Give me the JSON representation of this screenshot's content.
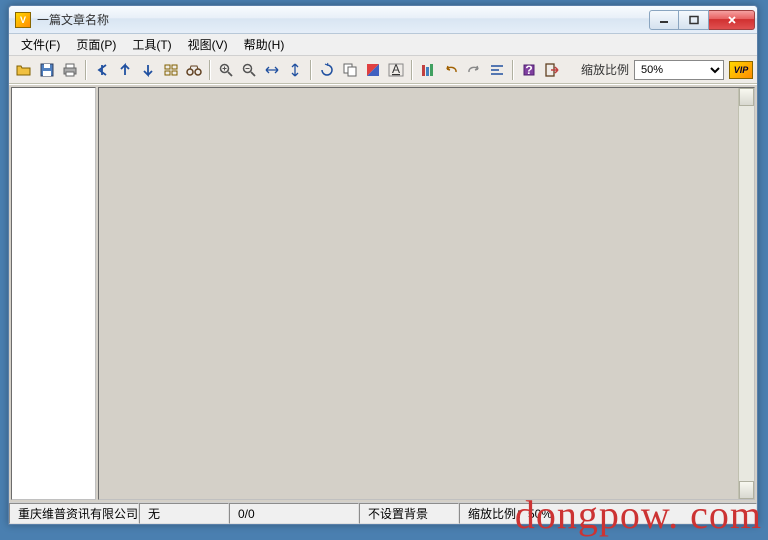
{
  "window": {
    "title": "一篇文章名称"
  },
  "menu": {
    "file": "文件(F)",
    "page": "页面(P)",
    "tools": "工具(T)",
    "view": "视图(V)",
    "help": "帮助(H)"
  },
  "toolbar": {
    "zoom_label": "缩放比例",
    "zoom_value": "50%",
    "icons": {
      "open": "open-icon",
      "save": "save-icon",
      "print": "print-icon",
      "first": "first-page-icon",
      "prev": "prev-page-icon",
      "next": "next-page-icon",
      "last": "last-page-icon",
      "thumb": "thumbnail-icon",
      "binoc": "binoculars-icon",
      "zoomin": "zoom-in-icon",
      "zoomout": "zoom-out-icon",
      "fitw": "fit-width-icon",
      "fith": "fit-height-icon",
      "rotate": "rotate-icon",
      "copy": "copy-icon",
      "contrast": "contrast-icon",
      "annot": "annotation-icon",
      "books": "bookshelf-icon",
      "undo": "undo-icon",
      "redo": "redo-icon",
      "align": "align-icon",
      "help": "help-icon",
      "exit": "exit-icon"
    }
  },
  "status": {
    "company": "重庆维普资讯有限公司",
    "value": "无",
    "page": "0/0",
    "background": "不设置背景",
    "zoom": "缩放比例：50%"
  },
  "watermark": "dongpow. com"
}
